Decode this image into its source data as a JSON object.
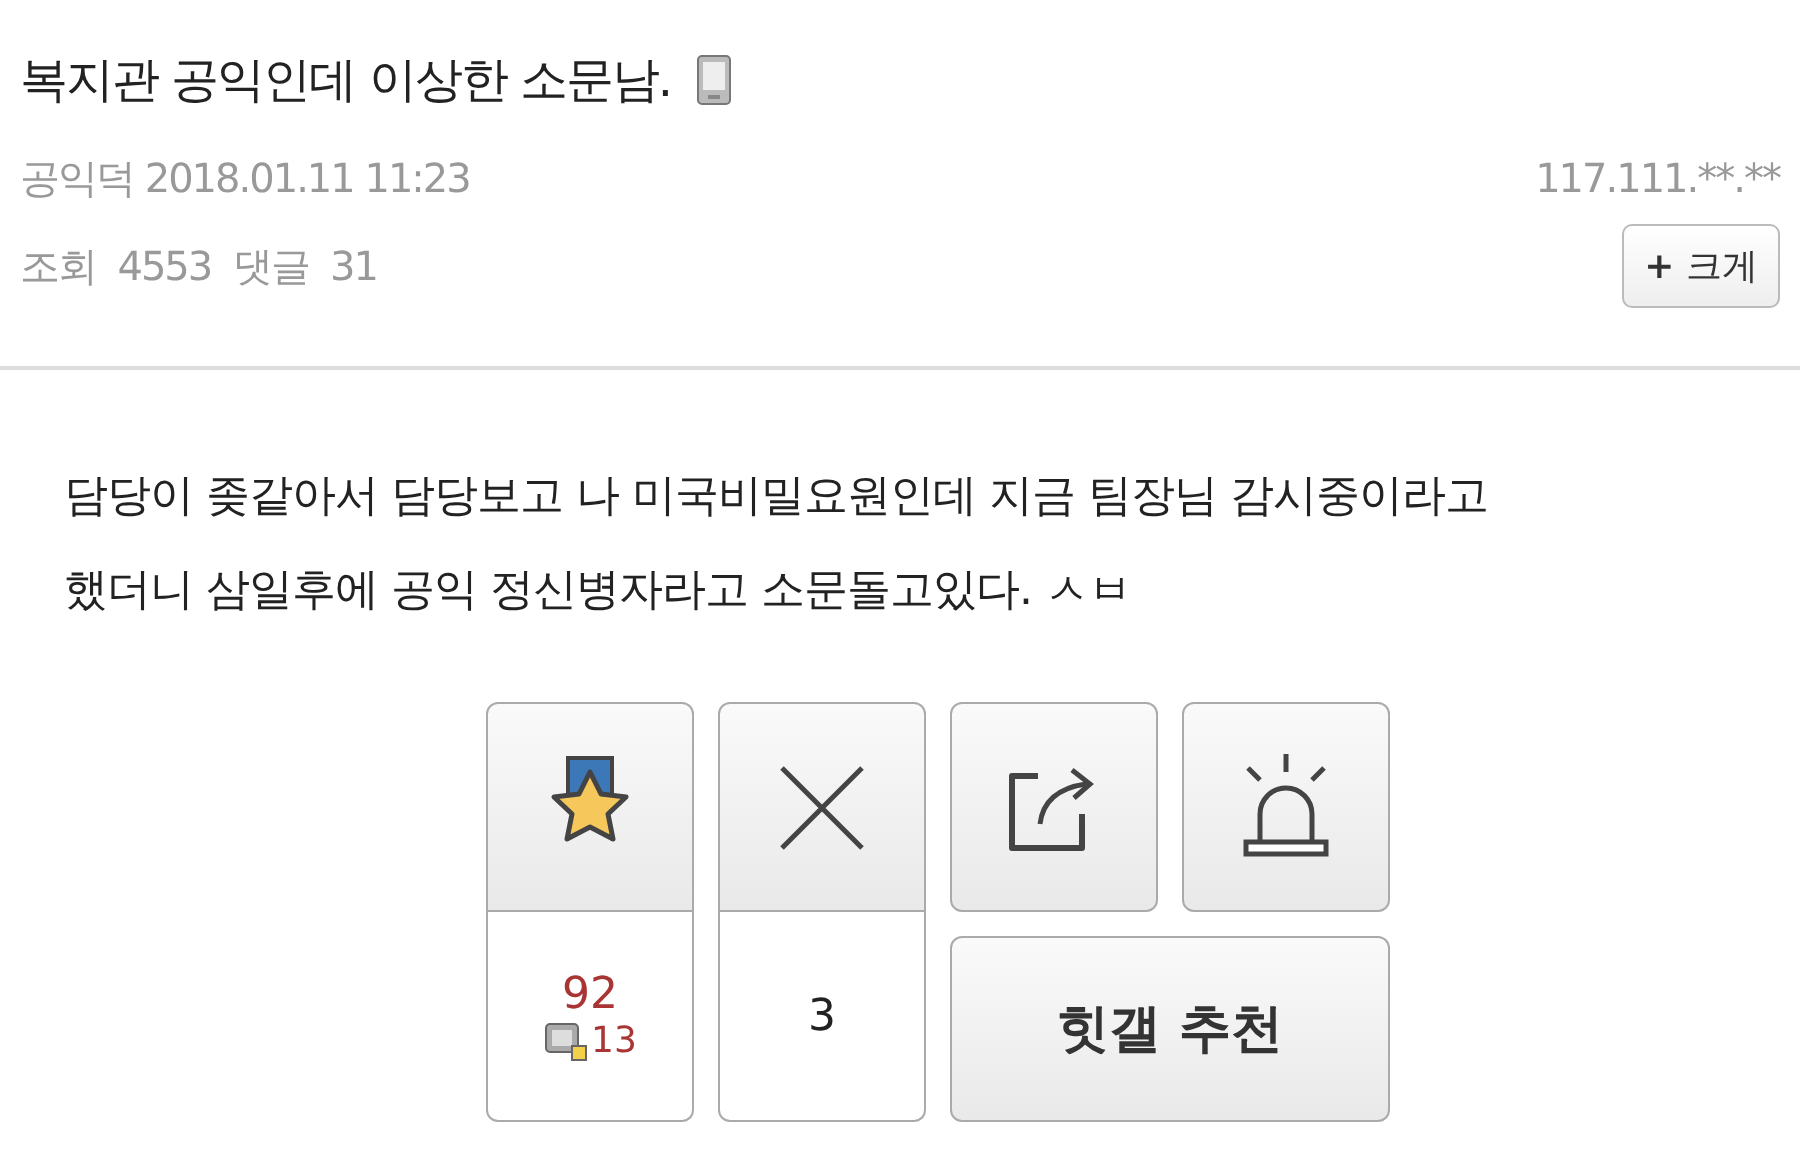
{
  "post": {
    "title": "복지관 공익인데 이상한 소문남.",
    "author": "공익덕",
    "datetime": "2018.01.11 11:23",
    "ip": "117.111.**.**",
    "views_label": "조회",
    "views": "4553",
    "comments_label": "댓글",
    "comments": "31",
    "enlarge_button": {
      "icon": "+",
      "label": "크게"
    }
  },
  "body": "담당이 좆같아서 담당보고 나 미국비밀요원인데  지금 팀장님 감시중이라고\n했더니 삼일후에  공익 정신병자라고 소문돌고있다. ㅅㅂ",
  "actions": {
    "recommend_count": "92",
    "fixed_count": "13",
    "downvote_count": "3",
    "hit_button": "힛갤 추천"
  }
}
